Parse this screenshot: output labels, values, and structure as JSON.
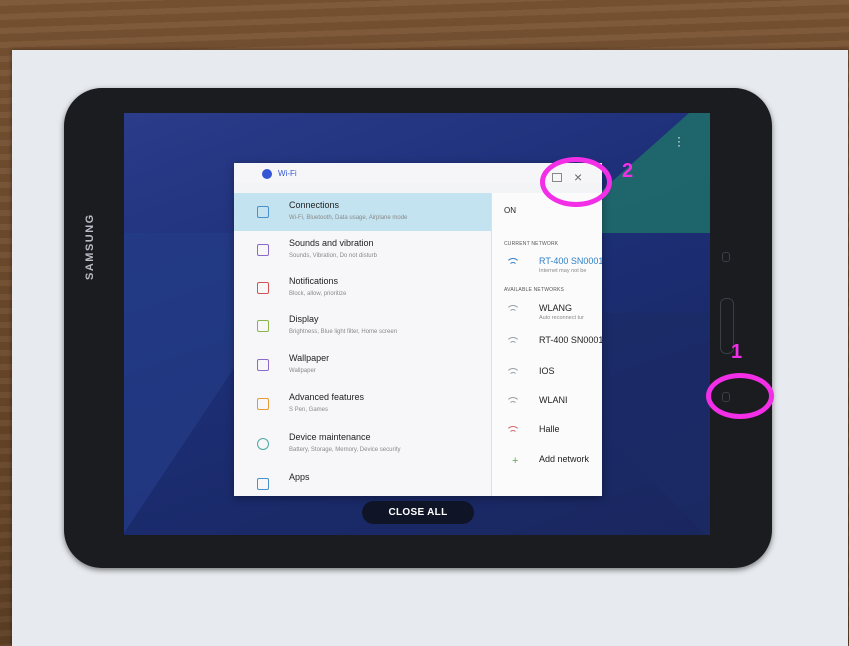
{
  "device": {
    "brand": "SAMSUNG"
  },
  "recents": {
    "close_all_label": "CLOSE ALL"
  },
  "card": {
    "title": "Wi-Fi"
  },
  "settings_menu": [
    {
      "title": "Connections",
      "subtitle": "Wi-Fi, Bluetooth, Data usage, Airplane mode",
      "active": true,
      "icon": "connections-icon"
    },
    {
      "title": "Sounds and vibration",
      "subtitle": "Sounds, Vibration, Do not disturb",
      "icon": "sound-icon"
    },
    {
      "title": "Notifications",
      "subtitle": "Block, allow, prioritize",
      "icon": "notifications-icon"
    },
    {
      "title": "Display",
      "subtitle": "Brightness, Blue light filter, Home screen",
      "icon": "display-icon"
    },
    {
      "title": "Wallpaper",
      "subtitle": "Wallpaper",
      "icon": "wallpaper-icon"
    },
    {
      "title": "Advanced features",
      "subtitle": "S Pen, Games",
      "icon": "advanced-features-icon"
    },
    {
      "title": "Device maintenance",
      "subtitle": "Battery, Storage, Memory, Device security",
      "icon": "device-maintenance-icon"
    },
    {
      "title": "Apps",
      "subtitle": "",
      "icon": "apps-icon"
    }
  ],
  "wifi": {
    "toggle_label": "ON",
    "current_network_label": "CURRENT NETWORK",
    "current_network": {
      "name": "RT-400 SN0001",
      "status": "Internet may not be"
    },
    "available_networks_label": "AVAILABLE NETWORKS",
    "available_networks": [
      {
        "name": "WLANG",
        "status": "Auto reconnect tur"
      },
      {
        "name": "RT-400 SN0001",
        "status": ""
      },
      {
        "name": "IOS",
        "status": ""
      },
      {
        "name": "WLANI",
        "status": ""
      },
      {
        "name": "Halle",
        "status": ""
      }
    ],
    "add_network_label": "Add network"
  },
  "annotations": {
    "marker_1": "1",
    "marker_2": "2"
  },
  "colors": {
    "annotation": "#f22fe6",
    "accent": "#3456d4",
    "active_row": "#c2e3ef"
  }
}
